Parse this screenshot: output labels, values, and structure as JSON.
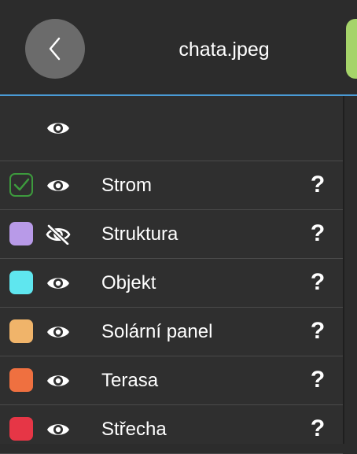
{
  "header": {
    "title": "chata.jpeg",
    "back_icon": "chevron-left-icon",
    "accent_color": "#a6d46a"
  },
  "list": {
    "header_icon": "eye-icon",
    "items": [
      {
        "label": "Strom",
        "color": "checkbox-checked",
        "visible": true,
        "help": "?"
      },
      {
        "label": "Struktura",
        "color": "#b89ae8",
        "visible": false,
        "help": "?"
      },
      {
        "label": "Objekt",
        "color": "#5fe6ef",
        "visible": true,
        "help": "?"
      },
      {
        "label": "Solární panel",
        "color": "#f0b46a",
        "visible": true,
        "help": "?"
      },
      {
        "label": "Terasa",
        "color": "#ef7040",
        "visible": true,
        "help": "?"
      },
      {
        "label": "Střecha",
        "color": "#e63646",
        "visible": true,
        "help": "?"
      }
    ]
  }
}
